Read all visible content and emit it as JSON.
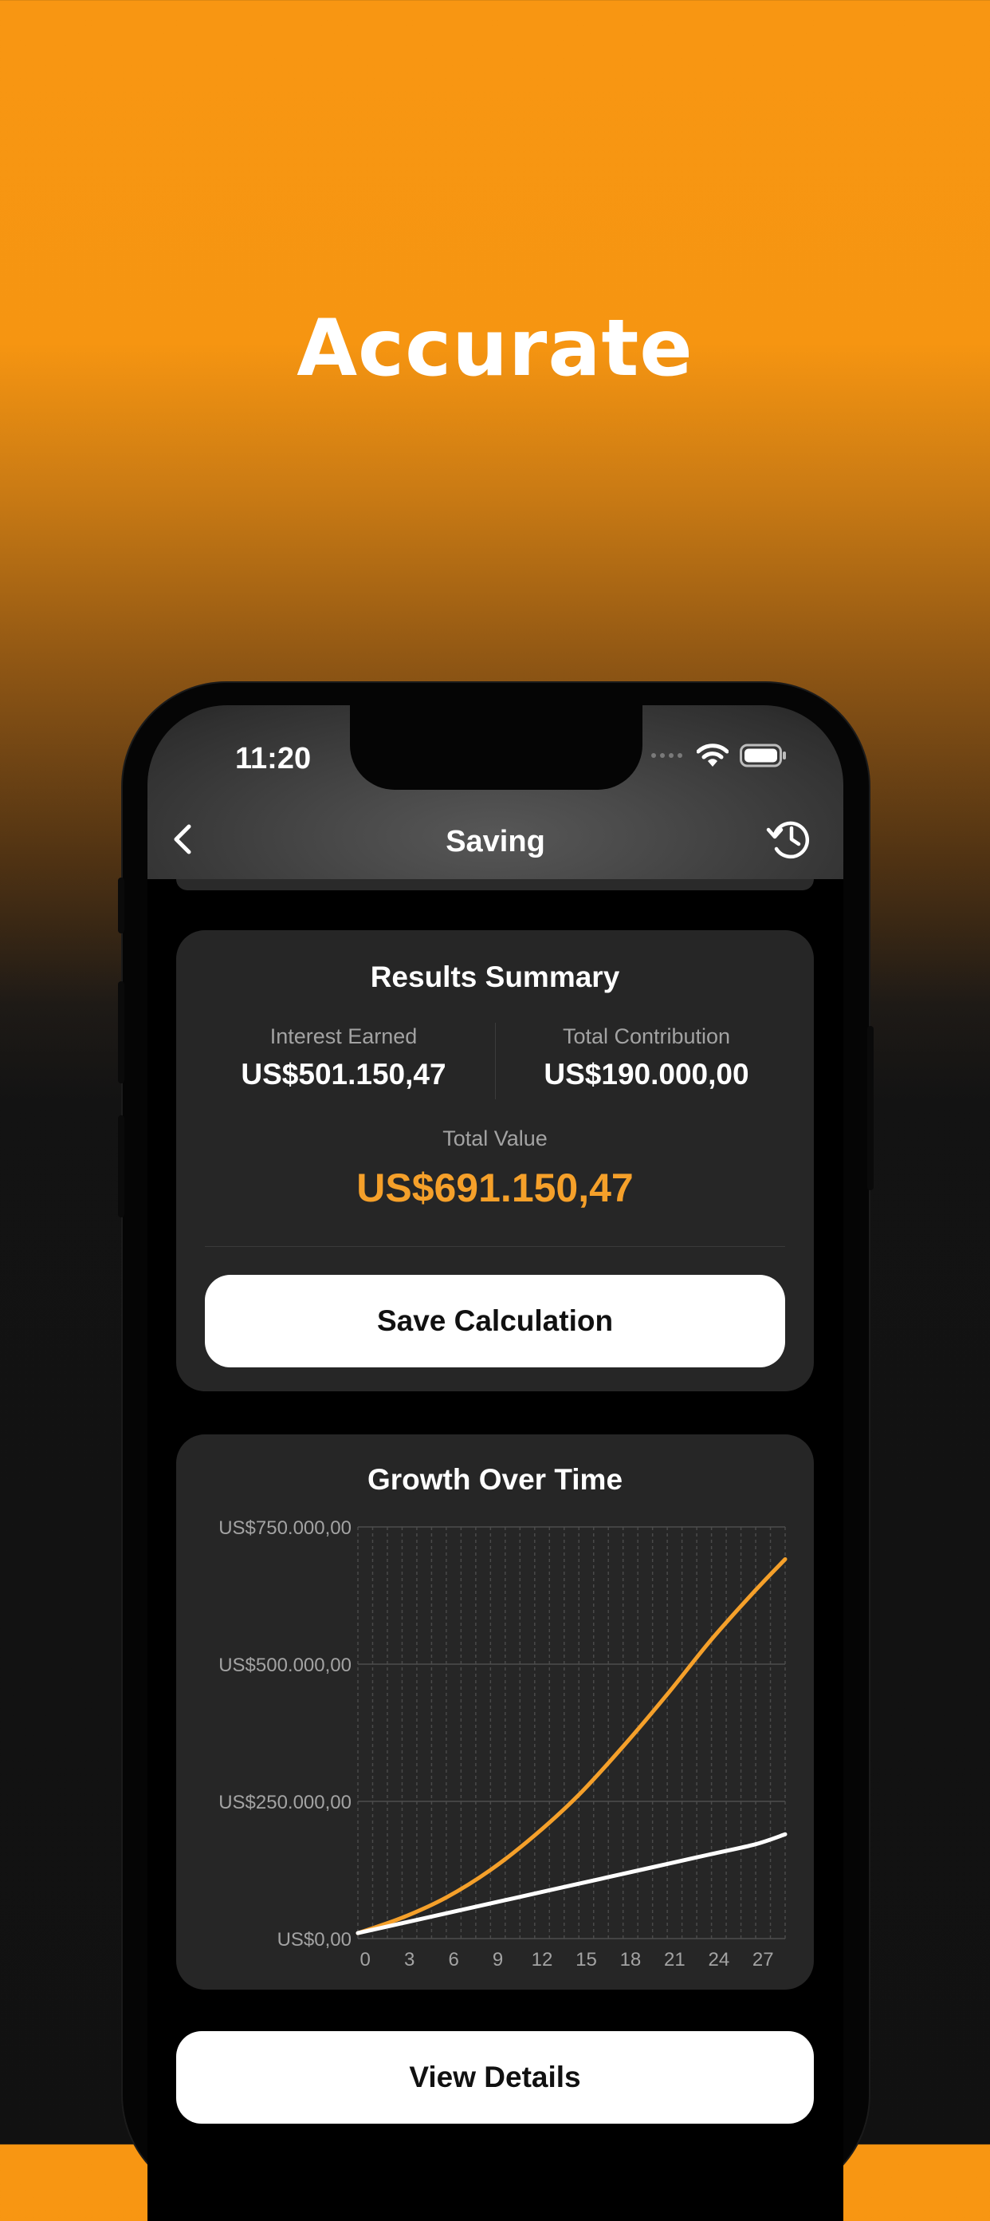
{
  "headline": "Accurate",
  "status_bar": {
    "time": "11:20"
  },
  "nav": {
    "title": "Saving"
  },
  "results": {
    "title": "Results Summary",
    "interest_label": "Interest Earned",
    "interest_value": "US$501.150,47",
    "contribution_label": "Total Contribution",
    "contribution_value": "US$190.000,00",
    "total_label": "Total Value",
    "total_value": "US$691.150,47",
    "save_button": "Save Calculation"
  },
  "growth": {
    "title": "Growth Over Time"
  },
  "view_details_button": "View Details",
  "colors": {
    "accent": "#f5a02a",
    "background_top": "#f89612",
    "card": "#262626"
  },
  "chart_data": {
    "type": "line",
    "title": "Growth Over Time",
    "xlabel": "",
    "ylabel": "",
    "x_ticks": [
      "0",
      "3",
      "6",
      "9",
      "12",
      "15",
      "18",
      "21",
      "24",
      "27"
    ],
    "y_ticks": [
      "US$0,00",
      "US$250.000,00",
      "US$500.000,00",
      "US$750.000,00"
    ],
    "xlim": [
      0,
      29
    ],
    "ylim": [
      0,
      750000
    ],
    "grid": true,
    "x": [
      0,
      3,
      6,
      9,
      12,
      15,
      18,
      21,
      24,
      27,
      29
    ],
    "series": [
      {
        "color": "#f5a02a",
        "values": [
          10000,
          38000,
          75000,
          125000,
          188000,
          262000,
          350000,
          445000,
          545000,
          635000,
          691150
        ]
      },
      {
        "color": "#ffffff",
        "values": [
          10000,
          28000,
          46000,
          64000,
          82000,
          100000,
          118000,
          136000,
          154000,
          172000,
          190000
        ]
      }
    ]
  }
}
